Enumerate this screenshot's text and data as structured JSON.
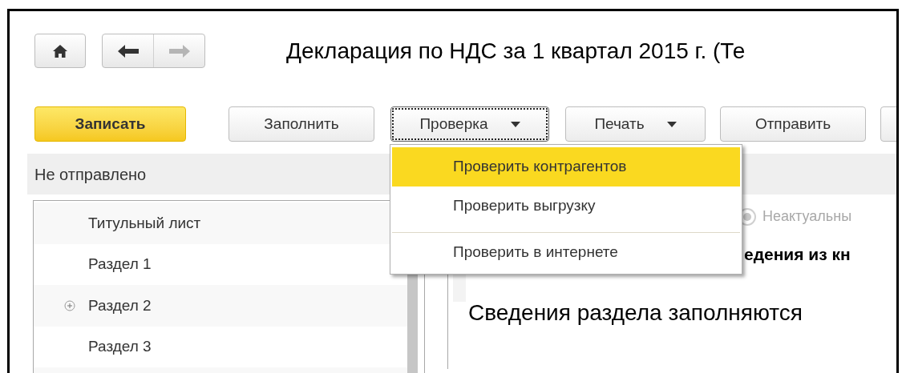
{
  "title": "Декларация по НДС за 1 квартал 2015 г. (Те",
  "toolbar": [
    {
      "kind": "primary",
      "label": "Записать",
      "dropdown": false,
      "focused": false
    },
    {
      "kind": "normal",
      "label": "Заполнить",
      "dropdown": false,
      "focused": false
    },
    {
      "kind": "normal",
      "label": "Проверка",
      "dropdown": true,
      "focused": true
    },
    {
      "kind": "normal",
      "label": "Печать",
      "dropdown": true,
      "focused": false
    },
    {
      "kind": "normal",
      "label": "Отправить",
      "dropdown": false,
      "focused": false
    },
    {
      "kind": "cut"
    }
  ],
  "status": "Не отправлено",
  "sections": [
    {
      "label": "Титульный лист",
      "expandable": false
    },
    {
      "label": "Раздел 1",
      "expandable": false
    },
    {
      "label": "Раздел 2",
      "expandable": true
    },
    {
      "label": "Раздел 3",
      "expandable": false
    }
  ],
  "relevance_radio": {
    "label": "Неактуальны",
    "selected": true,
    "disabled": true
  },
  "section_heading": "едения из кн",
  "section_text": "Сведения раздела заполняются",
  "menu": {
    "items": [
      {
        "label": "Проверить контрагентов",
        "selected": true,
        "separator_before": false
      },
      {
        "label": "Проверить выгрузку",
        "selected": false,
        "separator_before": false
      },
      {
        "label": "Проверить в интернете",
        "selected": false,
        "separator_before": true
      }
    ]
  }
}
